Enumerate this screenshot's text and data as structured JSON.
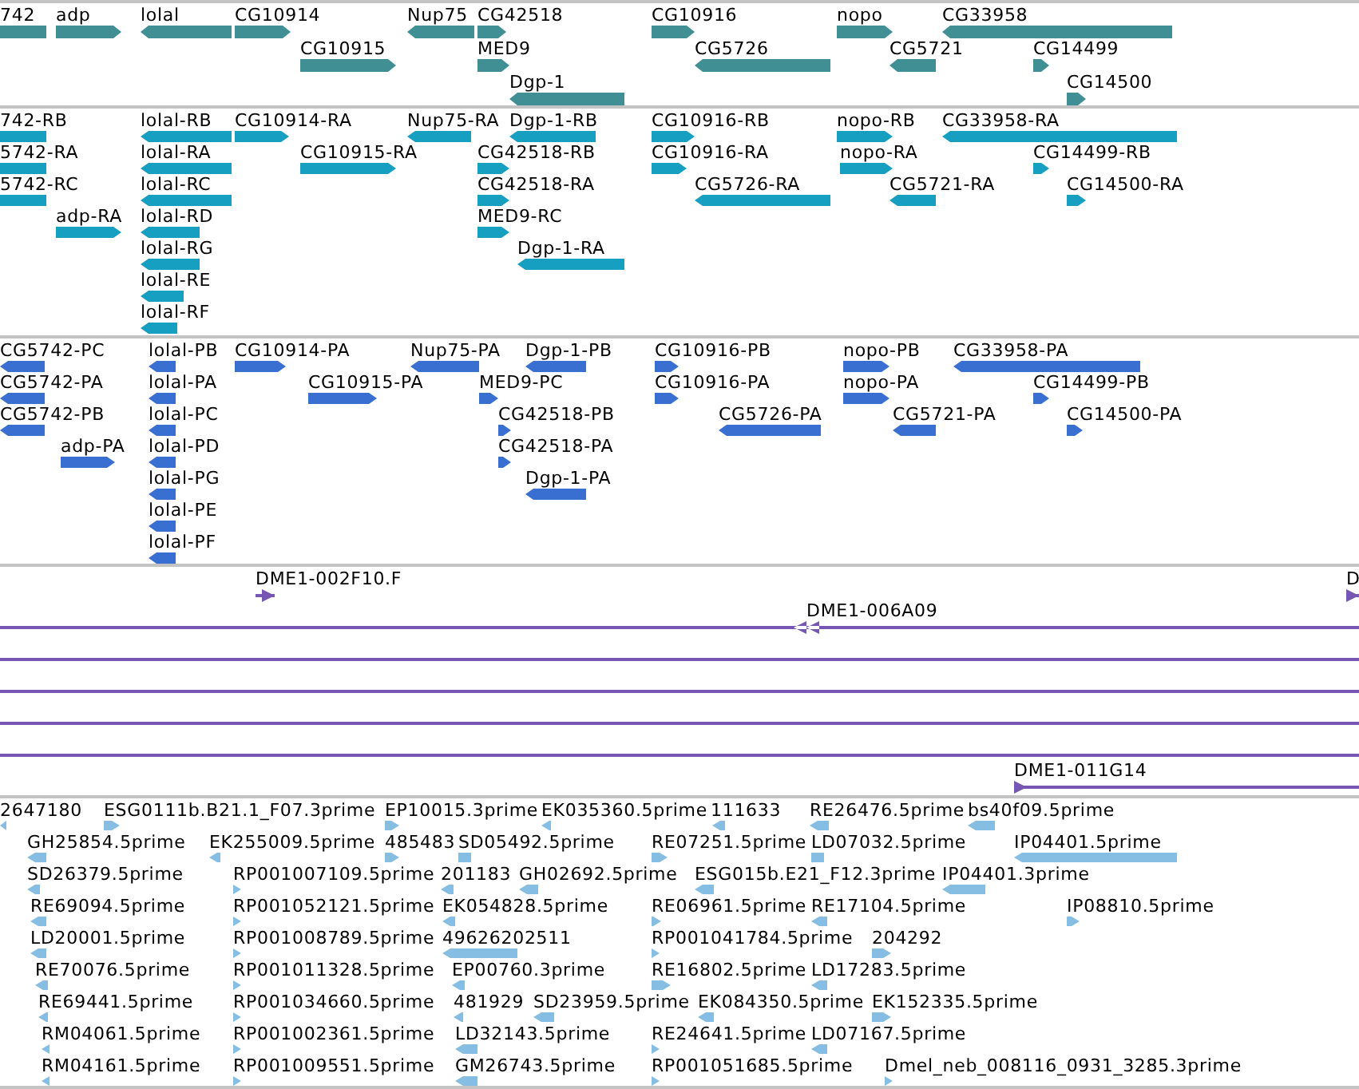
{
  "tracks": [
    {
      "kind": "gene",
      "features": [
        {
          "label": "742",
          "kind": "plain"
        },
        {
          "label": "adp",
          "kind": "forward"
        },
        {
          "label": "lolal",
          "kind": "reverse"
        },
        {
          "label": "CG10914",
          "kind": "forward"
        },
        {
          "label": "Nup75",
          "kind": "reverse"
        },
        {
          "label": "CG42518",
          "kind": "forward"
        },
        {
          "label": "CG10916",
          "kind": "forward"
        },
        {
          "label": "nopo",
          "kind": "forward"
        },
        {
          "label": "CG33958",
          "kind": "reverse"
        },
        {
          "label": "CG10915",
          "kind": "forward"
        },
        {
          "label": "MED9",
          "kind": "forward"
        },
        {
          "label": "CG5726",
          "kind": "reverse"
        },
        {
          "label": "CG5721",
          "kind": "reverse"
        },
        {
          "label": "CG14499",
          "kind": "forward"
        },
        {
          "label": "Dgp-1",
          "kind": "reverse"
        },
        {
          "label": "CG14500",
          "kind": "forward"
        }
      ]
    },
    {
      "kind": "transcript",
      "features": [
        {
          "label": "742-RB",
          "kind": "plain"
        },
        {
          "label": "lolal-RB",
          "kind": "reverse"
        },
        {
          "label": "CG10914-RA",
          "kind": "forward"
        },
        {
          "label": "Nup75-RA",
          "kind": "reverse"
        },
        {
          "label": "Dgp-1-RB",
          "kind": "reverse"
        },
        {
          "label": "CG10916-RB",
          "kind": "forward"
        },
        {
          "label": "nopo-RB",
          "kind": "forward"
        },
        {
          "label": "CG33958-RA",
          "kind": "reverse"
        },
        {
          "label": "5742-RA",
          "kind": "plain"
        },
        {
          "label": "lolal-RA",
          "kind": "reverse"
        },
        {
          "label": "CG10915-RA",
          "kind": "forward"
        },
        {
          "label": "CG42518-RB",
          "kind": "forward"
        },
        {
          "label": "CG10916-RA",
          "kind": "forward"
        },
        {
          "label": "nopo-RA",
          "kind": "forward"
        },
        {
          "label": "CG14499-RB",
          "kind": "forward"
        },
        {
          "label": "5742-RC",
          "kind": "plain"
        },
        {
          "label": "lolal-RC",
          "kind": "reverse"
        },
        {
          "label": "CG42518-RA",
          "kind": "forward"
        },
        {
          "label": "CG5726-RA",
          "kind": "reverse"
        },
        {
          "label": "CG5721-RA",
          "kind": "reverse"
        },
        {
          "label": "CG14500-RA",
          "kind": "forward"
        },
        {
          "label": "adp-RA",
          "kind": "forward"
        },
        {
          "label": "lolal-RD",
          "kind": "reverse"
        },
        {
          "label": "MED9-RC",
          "kind": "forward"
        },
        {
          "label": "lolal-RG",
          "kind": "reverse"
        },
        {
          "label": "Dgp-1-RA",
          "kind": "reverse"
        },
        {
          "label": "lolal-RE",
          "kind": "reverse"
        },
        {
          "label": "lolal-RF",
          "kind": "reverse"
        }
      ]
    },
    {
      "kind": "protein",
      "features": [
        {
          "label": "CG5742-PC",
          "kind": "reverse"
        },
        {
          "label": "lolal-PB",
          "kind": "reverse"
        },
        {
          "label": "CG10914-PA",
          "kind": "forward"
        },
        {
          "label": "Nup75-PA",
          "kind": "reverse"
        },
        {
          "label": "Dgp-1-PB",
          "kind": "reverse"
        },
        {
          "label": "CG10916-PB",
          "kind": "forward"
        },
        {
          "label": "nopo-PB",
          "kind": "forward"
        },
        {
          "label": "CG33958-PA",
          "kind": "reverse"
        },
        {
          "label": "CG5742-PA",
          "kind": "reverse"
        },
        {
          "label": "lolal-PA",
          "kind": "reverse"
        },
        {
          "label": "CG10915-PA",
          "kind": "forward"
        },
        {
          "label": "MED9-PC",
          "kind": "forward"
        },
        {
          "label": "CG10916-PA",
          "kind": "forward"
        },
        {
          "label": "nopo-PA",
          "kind": "forward"
        },
        {
          "label": "CG14499-PB",
          "kind": "forward"
        },
        {
          "label": "CG5742-PB",
          "kind": "reverse"
        },
        {
          "label": "lolal-PC",
          "kind": "reverse"
        },
        {
          "label": "CG42518-PB",
          "kind": "forward"
        },
        {
          "label": "CG5726-PA",
          "kind": "reverse"
        },
        {
          "label": "CG5721-PA",
          "kind": "reverse"
        },
        {
          "label": "CG14500-PA",
          "kind": "forward"
        },
        {
          "label": "adp-PA",
          "kind": "forward"
        },
        {
          "label": "lolal-PD",
          "kind": "reverse"
        },
        {
          "label": "CG42518-PA",
          "kind": "forward"
        },
        {
          "label": "lolal-PG",
          "kind": "reverse"
        },
        {
          "label": "Dgp-1-PA",
          "kind": "reverse"
        },
        {
          "label": "lolal-PE",
          "kind": "reverse"
        },
        {
          "label": "lolal-PF",
          "kind": "reverse"
        }
      ]
    },
    {
      "kind": "clone",
      "features": [
        {
          "label": "DME1-002F10.F",
          "kind": "forward"
        },
        {
          "label": "D",
          "kind": "forward"
        },
        {
          "label": "DME1-006A09",
          "kind": "reverse"
        },
        {
          "kind": "plain"
        },
        {
          "kind": "plain"
        },
        {
          "kind": "plain"
        },
        {
          "kind": "plain"
        },
        {
          "label": "DME1-011G14",
          "kind": "forward"
        }
      ]
    },
    {
      "kind": "est",
      "features": [
        {
          "label": "2647180",
          "kind": "reverse"
        },
        {
          "label": "ESG0111b.B21.1_F07.3prime",
          "kind": "forward"
        },
        {
          "label": "EP10015.3prime",
          "kind": "forward"
        },
        {
          "label": "EK035360.5prime",
          "kind": "reverse"
        },
        {
          "label": "111633",
          "kind": "reverse"
        },
        {
          "label": "RE26476.5prime",
          "kind": "reverse"
        },
        {
          "label": "bs40f09.5prime",
          "kind": "reverse"
        },
        {
          "label": "GH25854.5prime",
          "kind": "reverse"
        },
        {
          "label": "EK255009.5prime",
          "kind": "reverse"
        },
        {
          "label": "485483",
          "kind": "forward"
        },
        {
          "label": "SD05492.5prime",
          "kind": "plain"
        },
        {
          "label": "RE07251.5prime",
          "kind": "forward"
        },
        {
          "label": "LD07032.5prime",
          "kind": "plain"
        },
        {
          "label": "IP04401.5prime",
          "kind": "reverse"
        },
        {
          "label": "SD26379.5prime",
          "kind": "reverse"
        },
        {
          "label": "RP001007109.5prime",
          "kind": "forward"
        },
        {
          "label": "201183",
          "kind": "reverse"
        },
        {
          "label": "GH02692.5prime",
          "kind": "reverse"
        },
        {
          "label": "ESG015b.E21_F12.3prime",
          "kind": "reverse"
        },
        {
          "label": "IP04401.3prime",
          "kind": "reverse"
        },
        {
          "label": "RE69094.5prime",
          "kind": "reverse"
        },
        {
          "label": "RP001052121.5prime",
          "kind": "forward"
        },
        {
          "label": "EK054828.5prime",
          "kind": "reverse"
        },
        {
          "label": "RE06961.5prime",
          "kind": "forward"
        },
        {
          "label": "RE17104.5prime",
          "kind": "reverse"
        },
        {
          "label": "IP08810.5prime",
          "kind": "forward"
        },
        {
          "label": "LD20001.5prime",
          "kind": "reverse"
        },
        {
          "label": "RP001008789.5prime",
          "kind": "forward"
        },
        {
          "label": "49626202511",
          "kind": "reverse"
        },
        {
          "label": "RP001041784.5prime",
          "kind": "forward"
        },
        {
          "label": "204292",
          "kind": "forward"
        },
        {
          "label": "RE70076.5prime",
          "kind": "reverse"
        },
        {
          "label": "RP001011328.5prime",
          "kind": "forward"
        },
        {
          "label": "EP00760.3prime",
          "kind": "reverse"
        },
        {
          "label": "RE16802.5prime",
          "kind": "forward"
        },
        {
          "label": "LD17283.5prime",
          "kind": "reverse"
        },
        {
          "label": "RE69441.5prime",
          "kind": "reverse"
        },
        {
          "label": "RP001034660.5prime",
          "kind": "forward"
        },
        {
          "label": "481929",
          "kind": "reverse"
        },
        {
          "label": "SD23959.5prime",
          "kind": "reverse"
        },
        {
          "label": "EK084350.5prime",
          "kind": "reverse"
        },
        {
          "label": "EK152335.5prime",
          "kind": "forward"
        },
        {
          "label": "RM04061.5prime",
          "kind": "reverse"
        },
        {
          "label": "RP001002361.5prime",
          "kind": "forward"
        },
        {
          "label": "LD32143.5prime",
          "kind": "reverse"
        },
        {
          "label": "RE24641.5prime",
          "kind": "forward"
        },
        {
          "label": "LD07167.5prime",
          "kind": "reverse"
        },
        {
          "label": "RM04161.5prime",
          "kind": "reverse"
        },
        {
          "label": "RP001009551.5prime",
          "kind": "forward"
        },
        {
          "label": "GM26743.5prime",
          "kind": "reverse"
        },
        {
          "label": "RP001051685.5prime",
          "kind": "forward"
        },
        {
          "label": "Dmel_neb_008116_0931_3285.3prime",
          "kind": "forward"
        }
      ]
    }
  ]
}
